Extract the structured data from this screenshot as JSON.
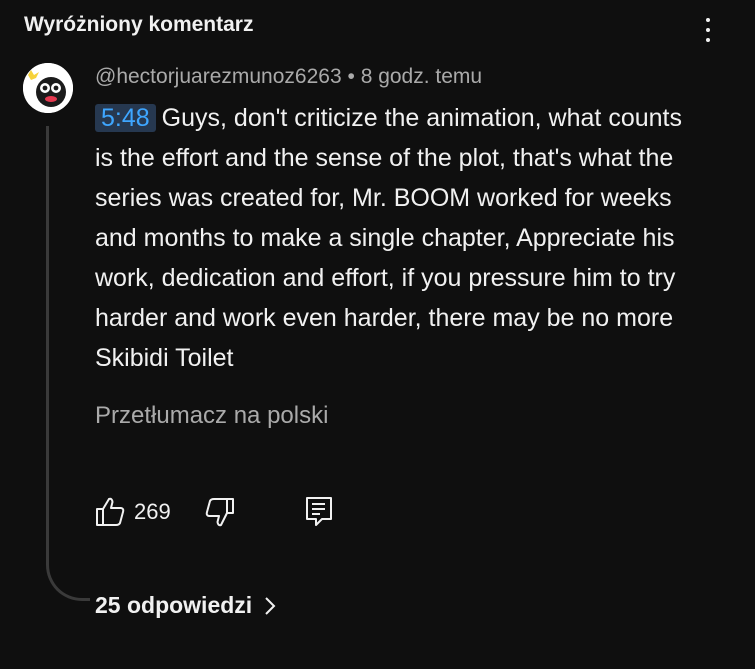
{
  "header": {
    "title": "Wyróżniony komentarz"
  },
  "comment": {
    "author": "@hectorjuarezmunoz6263",
    "separator": "•",
    "time": "8 godz. temu",
    "timestamp_link": "5:48",
    "text": "Guys, don't criticize the animation, what counts is the effort and the sense of the plot, that's what the series was created for, Mr. BOOM worked for weeks and months to make a single chapter, Appreciate his work, dedication and effort, if you pressure him to try harder and work even harder, there may be no more Skibidi Toilet",
    "translate_label": "Przetłumacz na polski"
  },
  "actions": {
    "like_count": "269",
    "icons": [
      "thumb-up-icon",
      "thumb-down-icon",
      "reply-icon",
      "more-vert-icon",
      "chevron-right-icon"
    ]
  },
  "replies": {
    "label": "25 odpowiedzi"
  },
  "colors": {
    "background": "#0f0f0f",
    "text_primary": "#f1f1f1",
    "text_secondary": "#aaaaaa",
    "timestamp_fg": "#3ea6ff",
    "timestamp_bg": "#263850"
  }
}
